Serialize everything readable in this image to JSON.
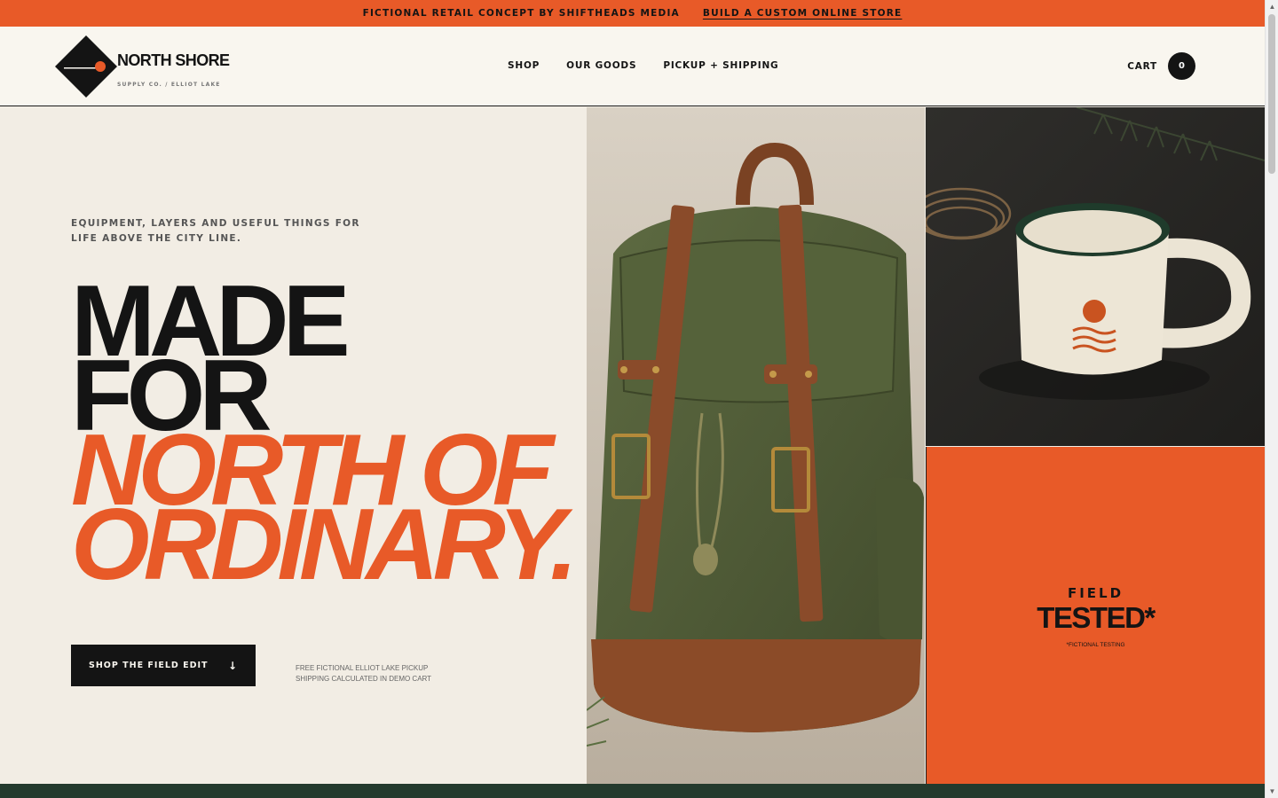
{
  "announcement": {
    "text": "FICTIONAL RETAIL CONCEPT BY SHIFTHEADS MEDIA",
    "link": "BUILD A CUSTOM ONLINE STORE"
  },
  "brand": {
    "name": "NORTH SHORE",
    "tagline": "SUPPLY CO. / ELLIOT LAKE",
    "accent": "#e85a28",
    "dark": "#141414",
    "cream": "#f2ede4",
    "forest": "#243a2d"
  },
  "nav": {
    "items": [
      "SHOP",
      "OUR GOODS",
      "PICKUP + SHIPPING"
    ]
  },
  "cart": {
    "label": "CART",
    "count": "0",
    "icon": "cart-badge"
  },
  "hero": {
    "eyebrow": "EQUIPMENT, LAYERS AND USEFUL THINGS FOR LIFE ABOVE THE CITY LINE.",
    "headline": [
      "MADE",
      "FOR",
      "NORTH OF",
      "ORDINARY."
    ],
    "cta_label": "SHOP THE FIELD EDIT",
    "cta_icon": "arrow-down-icon",
    "note_line1": "FREE FICTIONAL ELLIOT LAKE PICKUP",
    "note_line2": "SHIPPING CALCULATED IN DEMO CART"
  },
  "field": {
    "line1": "FIELD",
    "line2": "TESTED*",
    "footnote": "*FICTIONAL TESTING"
  }
}
